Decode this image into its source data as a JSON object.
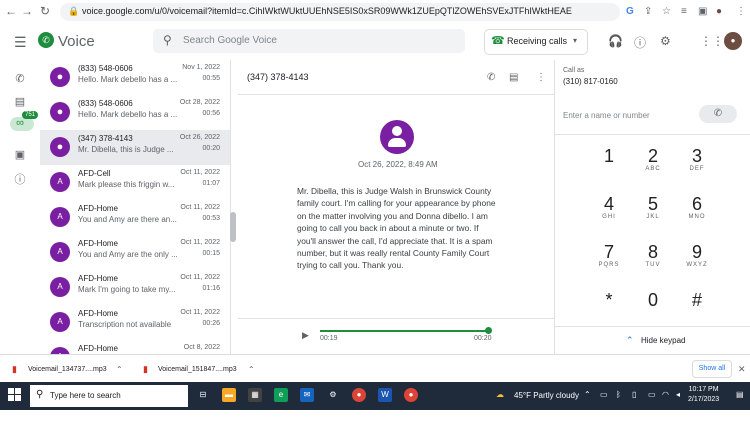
{
  "browser": {
    "url": "voice.google.com/u/0/voicemail?itemId=c.CihIWktWUktUUEhNSE5IS0xSR09WWk1ZUEpQTlZOWEhSVExJTFhIWktHEAE",
    "icons": [
      "back-icon",
      "forward-icon",
      "reload-icon",
      "lock-icon",
      "google-icon",
      "share-icon",
      "star-icon",
      "queue-icon",
      "extensions-icon",
      "profile-icon",
      "menu-icon"
    ]
  },
  "app": {
    "name": "Voice",
    "search_placeholder": "Search Google Voice",
    "receiving_calls": "Receiving calls"
  },
  "rail": {
    "badge": "751"
  },
  "list": [
    {
      "avatar": "",
      "name": "(833) 548-0606",
      "date": "Nov 1, 2022",
      "snippet": "Hello. Mark debello has a ...",
      "duration": "00:55",
      "selected": false
    },
    {
      "avatar": "",
      "name": "(833) 548-0606",
      "date": "Oct 28, 2022",
      "snippet": "Hello. Mark debello has a ...",
      "duration": "00:56",
      "selected": false
    },
    {
      "avatar": "",
      "name": "(347) 378-4143",
      "date": "Oct 26, 2022",
      "snippet": "Mr. Dibella, this is Judge ...",
      "duration": "00:20",
      "selected": true
    },
    {
      "avatar": "A",
      "name": "AFD-Cell",
      "date": "Oct 11, 2022",
      "snippet": "Mark please this friggin w...",
      "duration": "01:07",
      "selected": false
    },
    {
      "avatar": "A",
      "name": "AFD-Home",
      "date": "Oct 11, 2022",
      "snippet": "You and Amy are there an...",
      "duration": "00:53",
      "selected": false
    },
    {
      "avatar": "A",
      "name": "AFD-Home",
      "date": "Oct 11, 2022",
      "snippet": "You and Amy are the only ...",
      "duration": "00:15",
      "selected": false
    },
    {
      "avatar": "A",
      "name": "AFD-Home",
      "date": "Oct 11, 2022",
      "snippet": "Mark I'm going to take my...",
      "duration": "01:16",
      "selected": false
    },
    {
      "avatar": "A",
      "name": "AFD-Home",
      "date": "Oct 11, 2022",
      "snippet": "Transcription not available",
      "duration": "00:26",
      "selected": false
    },
    {
      "avatar": "A",
      "name": "AFD-Home",
      "date": "Oct 8, 2022",
      "snippet": "",
      "duration": "",
      "selected": false
    }
  ],
  "conversation": {
    "number": "(347) 378-4143",
    "date": "Oct 26, 2022, 8:49 AM",
    "transcript": "Mr. Dibella, this is Judge Walsh in Brunswick County family court. I'm calling for your appearance by phone on the matter involving you and Donna dibello. I am going to call you back in about a minute or two. If you'll answer the call, I'd appreciate that. It is a spam number, but it was really rental County Family Court trying to call you. Thank you.",
    "time_current": "00:19",
    "time_total": "00:20",
    "progress": 1.0
  },
  "dialer": {
    "call_as_label": "Call as",
    "call_as_number": "(310) 817-0160",
    "input_placeholder": "Enter a name or number",
    "keys": [
      {
        "digit": "1",
        "letters": ""
      },
      {
        "digit": "2",
        "letters": "ABC"
      },
      {
        "digit": "3",
        "letters": "DEF"
      },
      {
        "digit": "4",
        "letters": "GHI"
      },
      {
        "digit": "5",
        "letters": "JKL"
      },
      {
        "digit": "6",
        "letters": "MNO"
      },
      {
        "digit": "7",
        "letters": "PQRS"
      },
      {
        "digit": "8",
        "letters": "TUV"
      },
      {
        "digit": "9",
        "letters": "WXYZ"
      },
      {
        "digit": "*",
        "letters": ""
      },
      {
        "digit": "0",
        "letters": ""
      },
      {
        "digit": "#",
        "letters": ""
      }
    ],
    "hide_keypad": "Hide keypad"
  },
  "downloads": {
    "items": [
      "Voicemail_134737....mp3",
      "Voicemail_151847....mp3"
    ],
    "show_all": "Show all"
  },
  "taskbar": {
    "search_placeholder": "Type here to search",
    "weather": "45°F  Partly cloudy",
    "time": "10:17 PM",
    "date": "2/17/2023"
  }
}
